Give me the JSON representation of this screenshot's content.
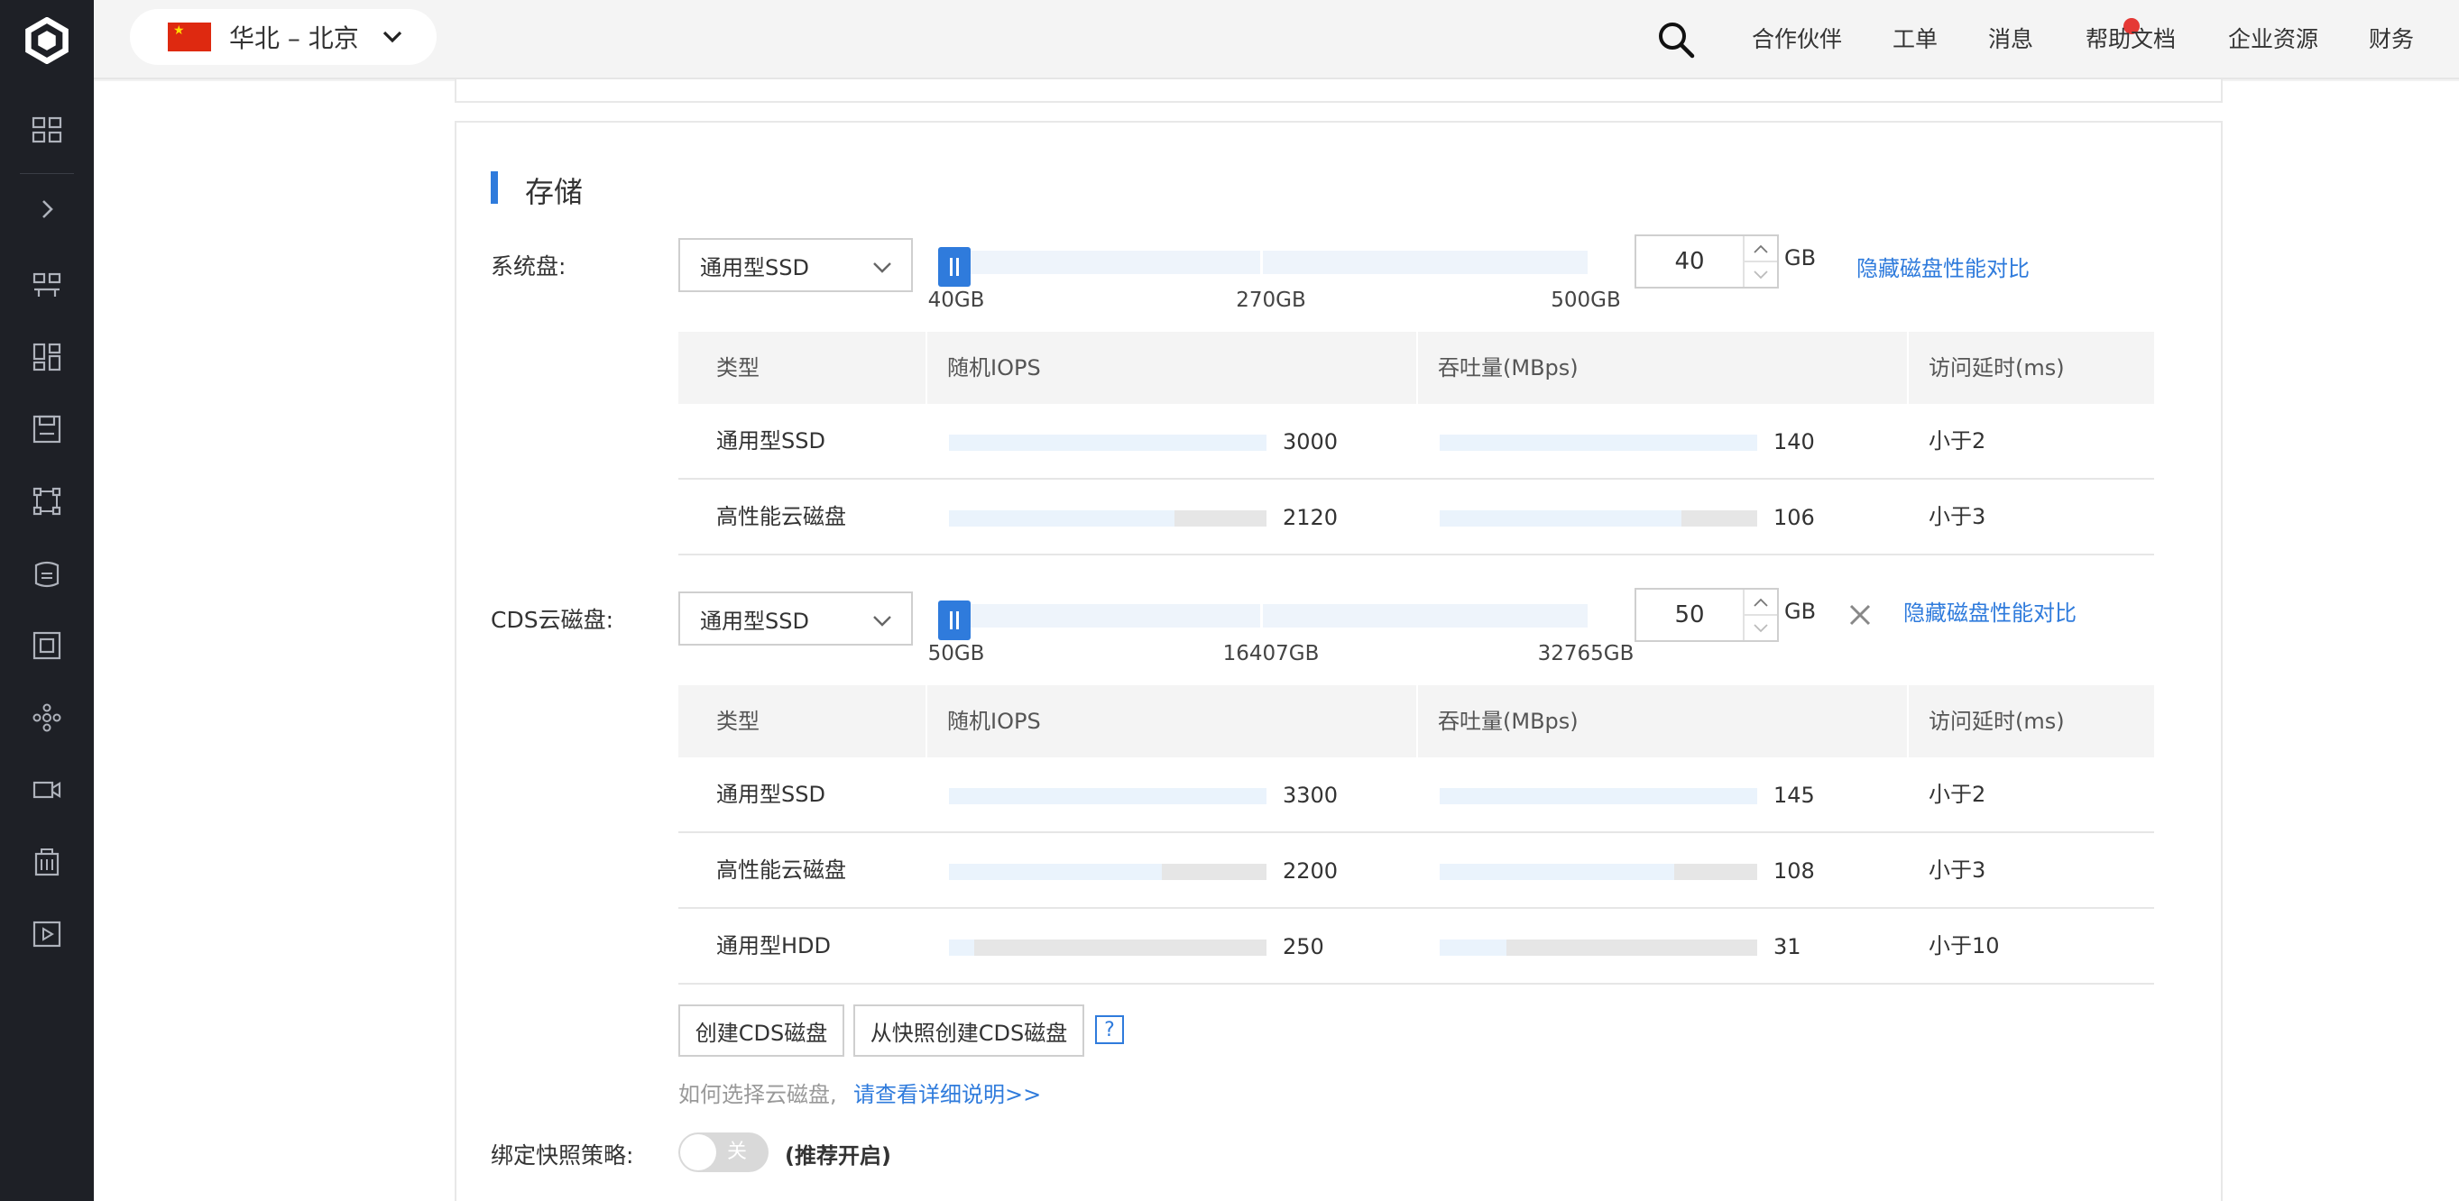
{
  "header": {
    "region": "华北 – 北京",
    "nav": [
      "合作伙伴",
      "工单",
      "消息",
      "帮助文档",
      "企业资源",
      "财务"
    ]
  },
  "sidebar": {
    "icons": [
      "logo-icon",
      "dashboard-icon",
      "expand-icon",
      "topology-icon",
      "grid-icon",
      "disk-icon",
      "network-icon",
      "database-icon",
      "chip-icon",
      "cluster-icon",
      "video-icon",
      "building-icon",
      "play-icon"
    ]
  },
  "storage": {
    "title": "存储",
    "system_disk": {
      "label": "系统盘:",
      "type": "通用型SSD",
      "ticks": [
        "40GB",
        "270GB",
        "500GB"
      ],
      "value": "40",
      "slider_level": 0,
      "unit": "GB",
      "toggle_link": "隐藏磁盘性能对比",
      "table": {
        "headers": [
          "类型",
          "随机IOPS",
          "吞吐量(MBps)",
          "访问延时(ms)"
        ],
        "rows": [
          {
            "type": "通用型SSD",
            "iops": "3000",
            "iops_fill": 1.0,
            "throughput": "140",
            "tp_fill": 1.0,
            "latency": "小于2"
          },
          {
            "type": "高性能云磁盘",
            "iops": "2120",
            "iops_fill": 0.71,
            "throughput": "106",
            "tp_fill": 0.76,
            "latency": "小于3"
          }
        ]
      }
    },
    "cds_disk": {
      "label": "CDS云磁盘:",
      "type": "通用型SSD",
      "ticks": [
        "50GB",
        "16407GB",
        "32765GB"
      ],
      "value": "50",
      "slider_level": 0,
      "unit": "GB",
      "toggle_link": "隐藏磁盘性能对比",
      "table": {
        "headers": [
          "类型",
          "随机IOPS",
          "吞吐量(MBps)",
          "访问延时(ms)"
        ],
        "rows": [
          {
            "type": "通用型SSD",
            "iops": "3300",
            "iops_fill": 1.0,
            "throughput": "145",
            "tp_fill": 1.0,
            "latency": "小于2"
          },
          {
            "type": "高性能云磁盘",
            "iops": "2200",
            "iops_fill": 0.67,
            "throughput": "108",
            "tp_fill": 0.74,
            "latency": "小于3"
          },
          {
            "type": "通用型HDD",
            "iops": "250",
            "iops_fill": 0.08,
            "throughput": "31",
            "tp_fill": 0.21,
            "latency": "小于10"
          }
        ]
      }
    },
    "create_cds_button": "创建CDS磁盘",
    "create_from_snapshot_button": "从快照创建CDS磁盘",
    "help_mark": "?",
    "hint_text": "如何选择云磁盘,",
    "hint_link": "请查看详细说明>>",
    "snapshot": {
      "label": "绑定快照策略:",
      "toggle_text": "关",
      "recommend": "(推荐开启)"
    }
  },
  "colors": {
    "accent": "#2f7bdc",
    "sidebar_bg": "#1e2026",
    "notify_dot": "#e53935"
  }
}
